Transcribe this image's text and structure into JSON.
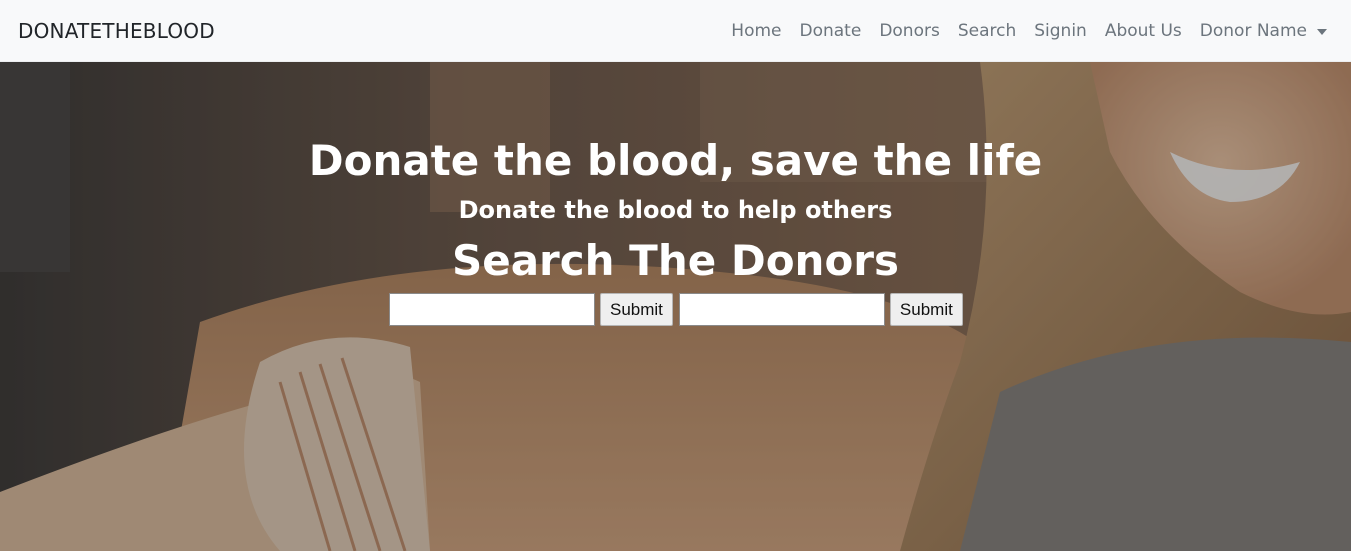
{
  "navbar": {
    "brand": "DONATETHEBLOOD",
    "items": [
      {
        "label": "Home"
      },
      {
        "label": "Donate"
      },
      {
        "label": "Donors"
      },
      {
        "label": "Search"
      },
      {
        "label": "Signin"
      },
      {
        "label": "About Us"
      },
      {
        "label": "Donor Name"
      }
    ]
  },
  "hero": {
    "title": "Donate the blood, save the life",
    "subtitle": "Donate the blood to help others",
    "search_title": "Search The Donors",
    "search_forms": [
      {
        "input_value": "",
        "button_label": "Submit"
      },
      {
        "input_value": "",
        "button_label": "Submit"
      }
    ]
  },
  "colors": {
    "navbar_bg": "#f8f9fa",
    "brand_text": "#212529",
    "nav_link": "#6c757d",
    "hero_text": "#ffffff"
  }
}
